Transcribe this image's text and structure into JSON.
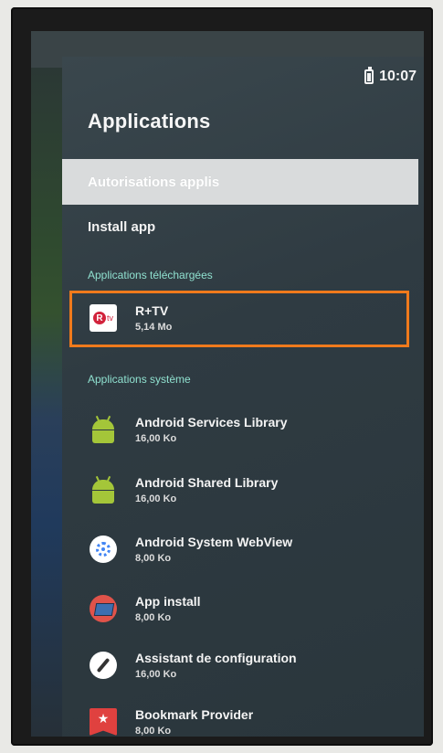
{
  "status_bar": {
    "time": "10:07",
    "battery_icon": "battery-icon"
  },
  "page": {
    "title": "Applications"
  },
  "menu": {
    "selected_item": "Autorisations applis",
    "install_item": "Install app"
  },
  "sections": {
    "downloaded": "Applications téléchargées",
    "system": "Applications système"
  },
  "downloaded_apps": [
    {
      "name": "R+TV",
      "size": "5,14 Mo",
      "icon": "rtv-icon",
      "icon_letter": "R",
      "icon_suffix": "tv"
    }
  ],
  "system_apps": [
    {
      "name": "Android Services Library",
      "size": "16,00 Ko",
      "icon": "android-icon"
    },
    {
      "name": "Android Shared Library",
      "size": "16,00 Ko",
      "icon": "android-icon"
    },
    {
      "name": "Android System WebView",
      "size": "8,00 Ko",
      "icon": "webview-icon"
    },
    {
      "name": "App install",
      "size": "8,00 Ko",
      "icon": "app-install-icon"
    },
    {
      "name": "Assistant de configuration",
      "size": "16,00 Ko",
      "icon": "compass-icon"
    },
    {
      "name": "Bookmark Provider",
      "size": "8,00 Ko",
      "icon": "bookmark-icon"
    }
  ],
  "colors": {
    "highlight_border": "#f07a1c",
    "section_header": "#8fe0cf",
    "selected_background": "#d9dbdc"
  }
}
